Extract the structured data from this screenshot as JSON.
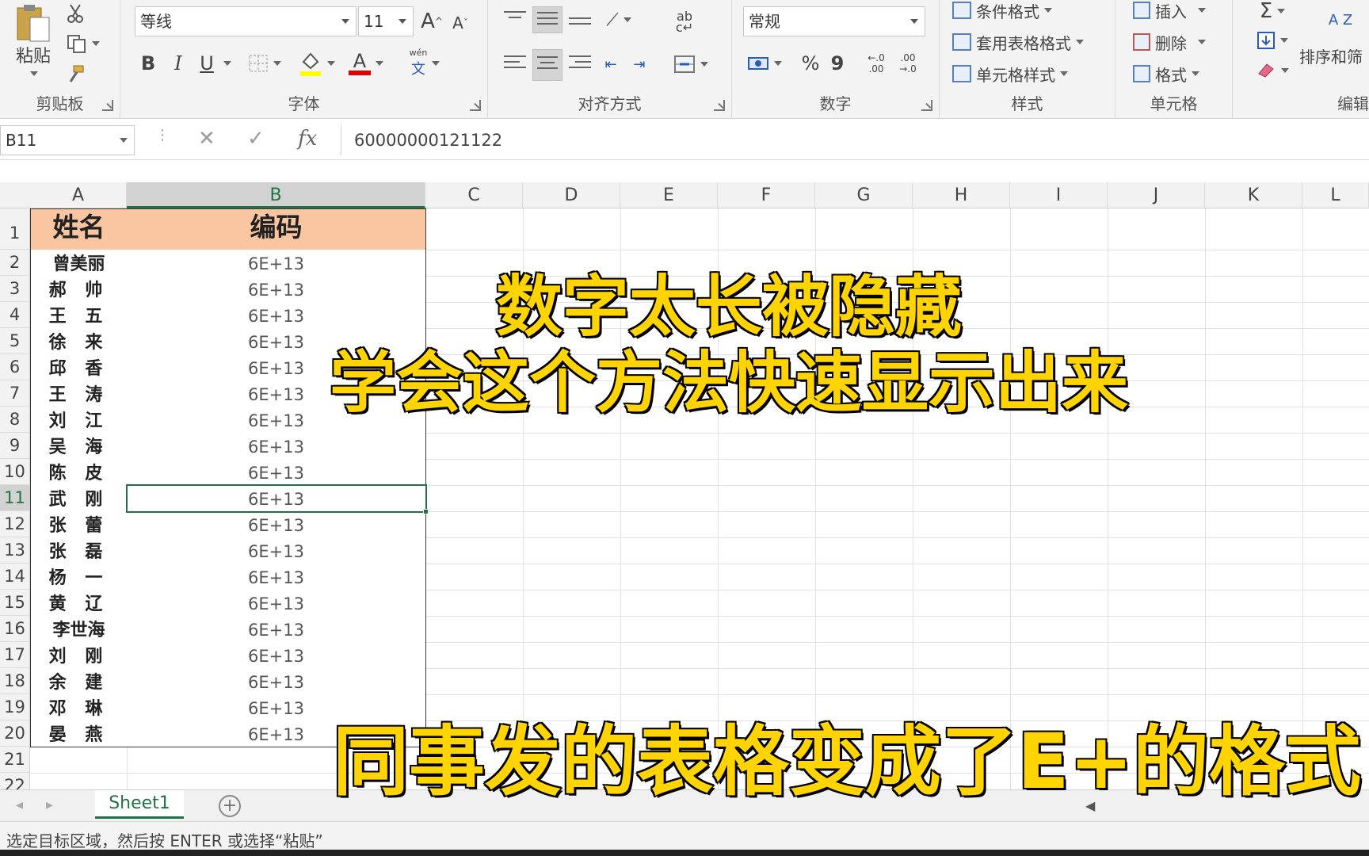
{
  "ribbon": {
    "clipboard": {
      "paste_label": "粘贴",
      "group_label": "剪贴板"
    },
    "font": {
      "font_name": "等线",
      "font_size": "11",
      "group_label": "字体",
      "grow_label": "A",
      "shrink_label": "A",
      "bold": "B",
      "italic": "I",
      "underline": "U",
      "font_color_glyph": "A",
      "phonetic_glyph": "wén"
    },
    "alignment": {
      "group_label": "对齐方式"
    },
    "number": {
      "format": "常规",
      "group_label": "数字",
      "percent": "%",
      "comma": "9",
      "inc_decimal": "←.0 .00",
      "dec_decimal": ".00 →.0"
    },
    "styles": {
      "conditional": "条件格式",
      "table_format": "套用表格格式",
      "cell_styles": "单元格样式",
      "group_label": "样式"
    },
    "cells": {
      "insert": "插入",
      "delete": "删除",
      "format": "格式",
      "group_label": "单元格"
    },
    "editing": {
      "sort_filter": "排序和筛",
      "group_label": "编辑",
      "sum_glyph": "Σ",
      "sort_glyph": "A Z"
    }
  },
  "formula_bar": {
    "name_box": "B11",
    "cancel_glyph": "✕",
    "enter_glyph": "✓",
    "fx_glyph": "fx",
    "formula": "60000000121122"
  },
  "columns": [
    "A",
    "B",
    "C",
    "D",
    "E",
    "F",
    "G",
    "H",
    "I",
    "J",
    "K",
    "L"
  ],
  "row_numbers": [
    "1",
    "2",
    "3",
    "4",
    "5",
    "6",
    "7",
    "8",
    "9",
    "10",
    "11",
    "12",
    "13",
    "14",
    "15",
    "16",
    "17",
    "18",
    "19",
    "20",
    "21",
    "22"
  ],
  "table": {
    "headers": [
      "姓名",
      "编码"
    ],
    "rows": [
      [
        "曾美丽",
        "6E+13"
      ],
      [
        "郝 帅",
        "6E+13"
      ],
      [
        "王 五",
        "6E+13"
      ],
      [
        "徐 来",
        "6E+13"
      ],
      [
        "邱 香",
        "6E+13"
      ],
      [
        "王 涛",
        "6E+13"
      ],
      [
        "刘 江",
        "6E+13"
      ],
      [
        "吴 海",
        "6E+13"
      ],
      [
        "陈 皮",
        "6E+13"
      ],
      [
        "武 刚",
        "6E+13"
      ],
      [
        "张 蕾",
        "6E+13"
      ],
      [
        "张 磊",
        "6E+13"
      ],
      [
        "杨 一",
        "6E+13"
      ],
      [
        "黄 辽",
        "6E+13"
      ],
      [
        "李世海",
        "6E+13"
      ],
      [
        "刘 刚",
        "6E+13"
      ],
      [
        "余 建",
        "6E+13"
      ],
      [
        "邓 琳",
        "6E+13"
      ],
      [
        "晏 燕",
        "6E+13"
      ]
    ]
  },
  "overlay": {
    "line1": "数字太长被隐藏",
    "line2": "学会这个方法快速显示出来",
    "caption": "同事发的表格变成了E+的格式"
  },
  "sheet_tabs": {
    "active": "Sheet1",
    "add_glyph": "+"
  },
  "status_bar": {
    "text": "选定目标区域，然后按 ENTER 或选择“粘贴”"
  },
  "colors": {
    "accent": "#217346",
    "header_fill": "#f9c6a1",
    "overlay_text": "#ffd400"
  }
}
